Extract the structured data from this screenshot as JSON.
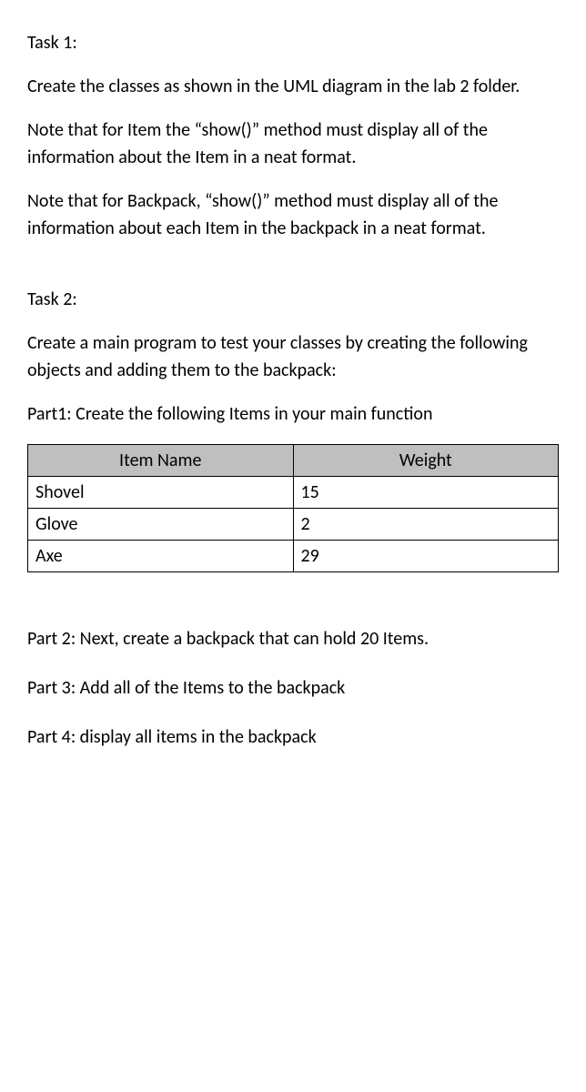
{
  "task1": {
    "heading": "Task 1:",
    "p1": "Create the classes as shown in the UML diagram in the lab 2 folder.",
    "p2": "Note that for Item the “show()” method must display all of the information about the Item in a neat format.",
    "p3": "Note that for Backpack, “show()” method must display all of the information about each Item in the backpack in a neat format."
  },
  "task2": {
    "heading": "Task 2:",
    "p1": "Create a main program to test your classes by creating the following objects and adding them to the backpack:",
    "part1_label": "Part1: Create the following Items in your main function",
    "table": {
      "headers": [
        "Item Name",
        "Weight"
      ],
      "rows": [
        {
          "name": "Shovel",
          "weight": "15"
        },
        {
          "name": "Glove",
          "weight": "2"
        },
        {
          "name": "Axe",
          "weight": "29"
        }
      ]
    },
    "part2": "Part 2: Next, create a backpack that can hold 20 Items.",
    "part3": "Part 3: Add all of the Items to the backpack",
    "part4": "Part 4: display all items in the backpack"
  }
}
